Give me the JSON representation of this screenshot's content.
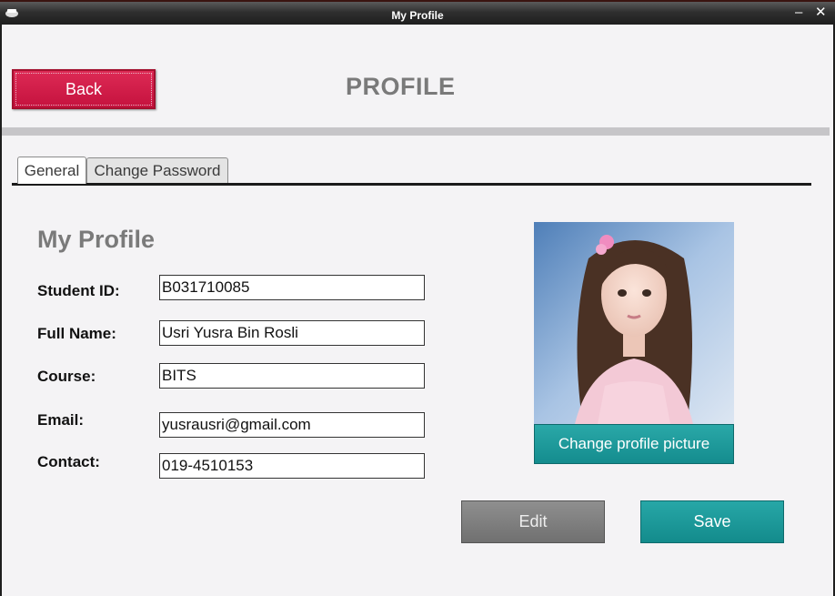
{
  "window": {
    "title": "My Profile",
    "minimize_glyph": "–",
    "close_glyph": "✕"
  },
  "header": {
    "back_label": "Back",
    "page_title": "PROFILE"
  },
  "tabs": [
    {
      "label": "General",
      "active": true
    },
    {
      "label": "Change Password",
      "active": false
    }
  ],
  "profile": {
    "section_title": "My Profile",
    "fields": [
      {
        "label": "Student ID:",
        "value": "B031710085"
      },
      {
        "label": "Full Name:",
        "value": "Usri Yusra Bin Rosli"
      },
      {
        "label": "Course:",
        "value": "BITS"
      },
      {
        "label": "Email:",
        "value": "yusrausri@gmail.com"
      },
      {
        "label": "Contact:",
        "value": "019-4510153"
      }
    ],
    "change_picture_label": "Change profile picture"
  },
  "actions": {
    "edit_label": "Edit",
    "save_label": "Save"
  },
  "colors": {
    "back_button": "#d21a48",
    "accent_teal": "#1a9a9b",
    "edit_button": "#808080",
    "title_gray": "#7a7a7a"
  },
  "icons": {
    "app": "app-icon",
    "minimize": "minimize-icon",
    "close": "close-icon"
  }
}
